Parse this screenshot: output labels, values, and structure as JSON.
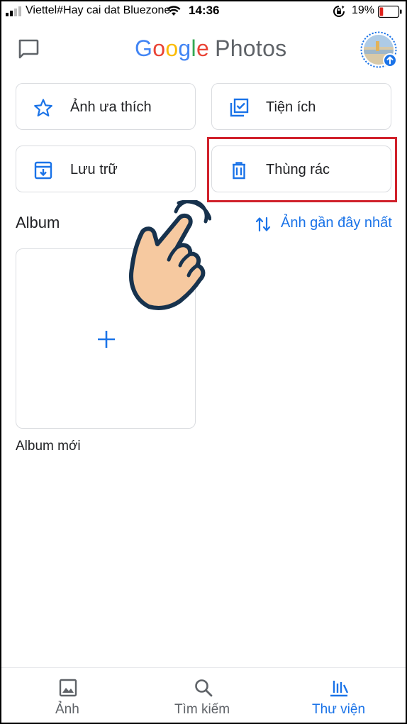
{
  "status_bar": {
    "carrier": "Viettel#Hay cai dat Bluezone",
    "time": "14:36",
    "battery_percent": "19%",
    "battery_level": 0.19,
    "icons": [
      "signal-icon",
      "wifi-icon",
      "rotation-lock-icon",
      "battery-icon"
    ]
  },
  "app_bar": {
    "logo_google": [
      "G",
      "o",
      "o",
      "g",
      "l",
      "e"
    ],
    "logo_photos": "Photos",
    "icons": [
      "message-icon",
      "avatar-backup-icon"
    ]
  },
  "shortcuts": [
    {
      "label": "Ảnh ưa thích",
      "icon": "star-icon"
    },
    {
      "label": "Tiện ích",
      "icon": "utilities-icon"
    },
    {
      "label": "Lưu trữ",
      "icon": "archive-icon"
    },
    {
      "label": "Thùng rác",
      "icon": "trash-icon"
    }
  ],
  "albums": {
    "title": "Album",
    "sort_label": "Ảnh gần đây nhất",
    "new_album_label": "Album mới"
  },
  "bottom_nav": [
    {
      "label": "Ảnh",
      "icon": "photo-icon"
    },
    {
      "label": "Tìm kiếm",
      "icon": "search-icon"
    },
    {
      "label": "Thư viện",
      "icon": "library-icon",
      "active": true
    }
  ],
  "colors": {
    "accent": "#1a73e8",
    "highlight": "#d0212b",
    "text": "#202124",
    "muted": "#5f6368"
  }
}
